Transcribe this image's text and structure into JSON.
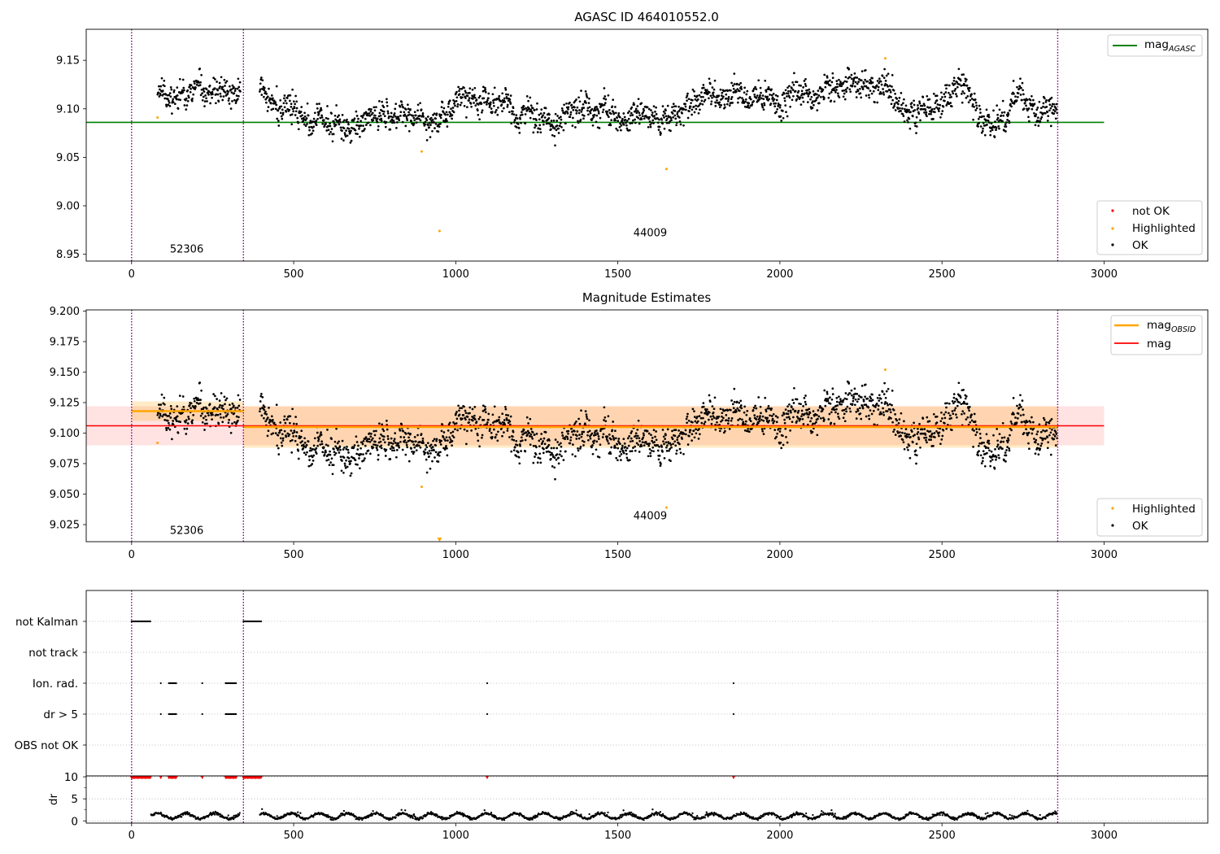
{
  "figure_title": "AGASC ID 464010552.0",
  "colors": {
    "ok": "#000000",
    "highlighted": "#ffa500",
    "not_ok": "#ff0000",
    "mag_agasc": "#008000",
    "mag_obsid": "#ffa500",
    "mag": "#ff0000",
    "obs_boundary": "#800080",
    "grid": "#b0b0b0"
  },
  "chart_data": [
    {
      "type": "scatter",
      "title": "AGASC ID 464010552.0",
      "xlim": [
        -140,
        3320
      ],
      "ylim": [
        8.943,
        9.182
      ],
      "x_ticks": [
        "0",
        "500",
        "1000",
        "1500",
        "2000",
        "2500",
        "3000"
      ],
      "y_ticks": [
        "8.95",
        "9.00",
        "9.05",
        "9.10",
        "9.15"
      ],
      "legend_top": {
        "placement": "top-right",
        "entries": [
          {
            "name": "mag",
            "subscript": "AGASC"
          }
        ]
      },
      "legend_bottom": {
        "placement": "bottom-right",
        "entries": [
          "not OK",
          "Highlighted",
          "OK"
        ]
      },
      "mag_agasc": {
        "value": 9.086,
        "x_range": [
          -140,
          3000
        ]
      },
      "obs_boundaries": [
        0,
        345,
        2857
      ],
      "obs_labels": [
        {
          "text": "52306",
          "x": 170,
          "y": 8.955
        },
        {
          "text": "44009",
          "x": 1600,
          "y": 8.972
        }
      ],
      "highlighted_points": [
        [
          80,
          9.091
        ],
        [
          895,
          9.056
        ],
        [
          950,
          8.974
        ],
        [
          1650,
          9.038
        ],
        [
          2325,
          9.152
        ]
      ]
    },
    {
      "type": "scatter",
      "title": "Magnitude Estimates",
      "xlim": [
        -140,
        3320
      ],
      "ylim": [
        9.011,
        9.201
      ],
      "x_ticks": [
        "0",
        "500",
        "1000",
        "1500",
        "2000",
        "2500",
        "3000"
      ],
      "y_ticks": [
        "9.025",
        "9.050",
        "9.075",
        "9.100",
        "9.125",
        "9.150",
        "9.175",
        "9.200"
      ],
      "legend_top": {
        "placement": "top-right",
        "entries": [
          {
            "name": "mag",
            "subscript": "OBSID"
          },
          {
            "name": "mag",
            "subscript": ""
          }
        ]
      },
      "legend_bottom": {
        "placement": "bottom-right",
        "entries": [
          "Highlighted",
          "OK"
        ]
      },
      "mag": {
        "value": 9.106,
        "band": [
          9.09,
          9.122
        ],
        "x_range": [
          -140,
          3000
        ]
      },
      "mag_obsid": [
        {
          "x_range": [
            0,
            345
          ],
          "value": 9.118,
          "band": [
            9.11,
            9.126
          ]
        },
        {
          "x_range": [
            345,
            2857
          ],
          "value": 9.105,
          "band": [
            9.088,
            9.122
          ]
        }
      ],
      "obs_boundaries": [
        0,
        345,
        2857
      ],
      "obs_labels": [
        {
          "text": "52306",
          "x": 170,
          "y": 9.02
        },
        {
          "text": "44009",
          "x": 1600,
          "y": 9.032
        }
      ],
      "highlighted_points": [
        [
          80,
          9.092
        ],
        [
          895,
          9.056
        ],
        [
          950,
          9.013
        ],
        [
          1650,
          9.039
        ],
        [
          2325,
          9.152
        ]
      ]
    },
    {
      "type": "scatter",
      "xlim": [
        -140,
        3320
      ],
      "x_ticks": [
        "0",
        "500",
        "1000",
        "1500",
        "2000",
        "2500",
        "3000"
      ],
      "flag_categories": [
        "not Kalman",
        "not track",
        "Ion. rad.",
        "dr > 5",
        "OBS not OK"
      ],
      "flag_ranges": {
        "not Kalman": [
          [
            0,
            60
          ],
          [
            345,
            400
          ]
        ],
        "not track": [],
        "Ion. rad.": [
          [
            90,
            92
          ],
          [
            115,
            140
          ],
          [
            218,
            220
          ],
          [
            290,
            325
          ],
          [
            1097,
            1099
          ],
          [
            1857,
            1859
          ]
        ],
        "dr > 5": [
          [
            90,
            92
          ],
          [
            115,
            140
          ],
          [
            218,
            220
          ],
          [
            290,
            325
          ],
          [
            1097,
            1099
          ],
          [
            1857,
            1859
          ]
        ],
        "OBS not OK": []
      },
      "dr": {
        "ylabel": "dr",
        "y_ticks": [
          "0",
          "5",
          "10"
        ],
        "ylim": [
          -0.5,
          10.2
        ],
        "typical_range": [
          0.3,
          2.2
        ],
        "not_ok_clusters": [
          [
            0,
            60
          ],
          [
            90,
            92
          ],
          [
            115,
            140
          ],
          [
            218,
            220
          ],
          [
            290,
            325
          ],
          [
            345,
            400
          ],
          [
            1097,
            1099
          ],
          [
            1857,
            1859
          ]
        ]
      },
      "obs_boundaries": [
        0,
        345,
        2857
      ]
    }
  ]
}
